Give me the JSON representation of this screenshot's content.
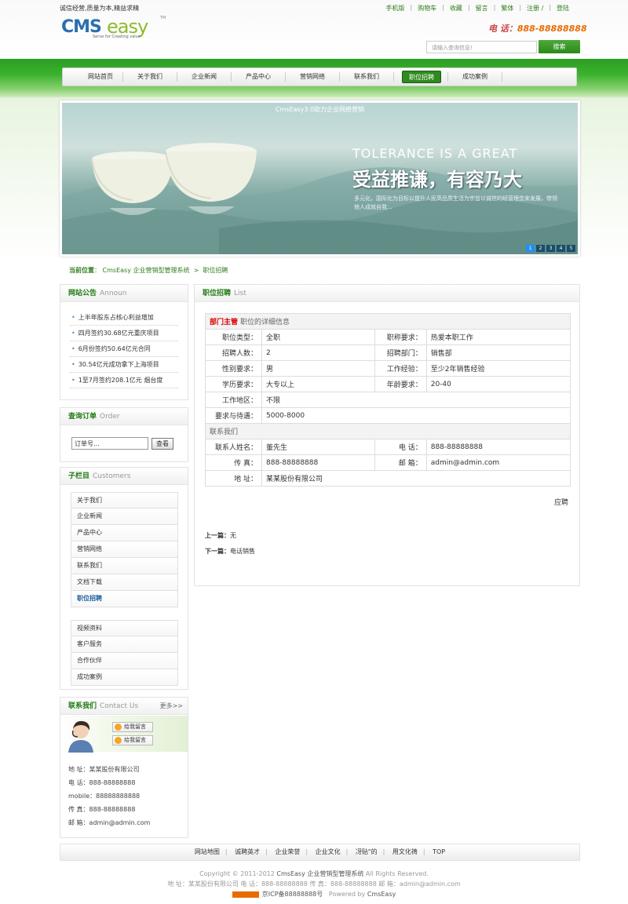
{
  "top": {
    "slogan": "诚信经营,质量为本,精益求精",
    "links": [
      "手机版",
      "购物车",
      "收藏",
      "留言",
      "繁体",
      "注册 /",
      "登陆"
    ]
  },
  "logo": {
    "cms": "CMS",
    "easy": "easy",
    "tm": "TM",
    "tagline": "Serve for Creating value"
  },
  "header": {
    "phone_label": "电 话：",
    "phone_number": "888-88888888",
    "search_placeholder": "请输入查询信息!",
    "search_button": "搜索"
  },
  "nav": {
    "items": [
      "网站首页",
      "关于我们",
      "企业新闻",
      "产品中心",
      "营销网络",
      "联系我们",
      "职位招聘",
      "成功案例"
    ],
    "active_index": 6
  },
  "banner": {
    "title": "CmsEasy3.0助力企业网络营销",
    "en": "TOLERANCE IS A GREAT",
    "cn": "受益推谦，有容乃大",
    "sub": "多元化，国际化为目标以提升人民高品质生活为宗旨以诚信的经营理念来发展，带领他人成就自我...",
    "dots": [
      "1",
      "2",
      "3",
      "4",
      "5"
    ]
  },
  "breadcrumb": {
    "label": "当前位置",
    "sep1": "：",
    "home": "CmsEasy 企业营销型管理系统",
    "sep2": ">",
    "current": "职位招聘"
  },
  "notice": {
    "title": "网站公告",
    "title_en": "Announ",
    "items": [
      "上半年股东占核心利益增加",
      "四月签约30.68亿元重庆项目",
      "6月份签约50.64亿元合同",
      "30.54亿元成功拿下上海项目",
      "1至7月签约208.1亿元 烟台度"
    ]
  },
  "order": {
    "title": "查询订单",
    "title_en": "Order",
    "input_value": "订单号...",
    "button": "查看"
  },
  "subnav": {
    "title": "子栏目",
    "title_en": "Customers",
    "group1": [
      "关于我们",
      "企业新闻",
      "产品中心",
      "营销网络",
      "联系我们",
      "文档下载",
      "职位招聘"
    ],
    "group2": [
      "视频资料",
      "客户服务",
      "合作伙伴",
      "成功案例"
    ],
    "active": "职位招聘"
  },
  "contact": {
    "title": "联系我们",
    "title_en": "Contact Us",
    "more": "更多>>",
    "qq_buttons": [
      "给我留言",
      "给我留言"
    ],
    "lines": [
      "地 址：某某股份有限公司",
      "电 话：888-88888888",
      "mobile：88888888888",
      "传 真：888-88888888",
      "邮 箱：admin@admin.com"
    ]
  },
  "main": {
    "title": "职位招聘",
    "title_en": "List",
    "section_title": "部门主管",
    "section_sub": "职位的详细信息",
    "rows": [
      {
        "l1": "职位类型：",
        "v1": "全职",
        "l2": "职称要求：",
        "v2": "热爱本职工作"
      },
      {
        "l1": "招聘人数：",
        "v1": "2",
        "l2": "招聘部门：",
        "v2": "销售部"
      },
      {
        "l1": "性别要求：",
        "v1": "男",
        "l2": "工作经验：",
        "v2": "至少2年销售经验"
      },
      {
        "l1": "学历要求：",
        "v1": "大专以上",
        "l2": "年龄要求：",
        "v2": "20-40"
      }
    ],
    "area_label": "工作地区：",
    "area_value": "不限",
    "pay_label": "要求与待遇：",
    "pay_value": "5000-8000",
    "contact_section": "联系我们",
    "contact_rows": [
      {
        "l1": "联系人姓名：",
        "v1": "董先生",
        "l2": "电 话：",
        "v2": "888-88888888"
      },
      {
        "l1": "传 真：",
        "v1": "888-88888888",
        "l2": "邮 箱：",
        "v2": "admin@admin.com"
      }
    ],
    "address_label": "地 址：",
    "address_value": "某某股份有限公司",
    "apply": "应聘",
    "prev_label": "上一篇：",
    "prev_value": "无",
    "next_label": "下一篇：",
    "next_value": "电话销售"
  },
  "footer": {
    "links": [
      "网站地图",
      "诚聘英才",
      "企业荣誉",
      "企业文化",
      "冴贴\"的",
      "用文化祷",
      "TOP"
    ],
    "copyright_pre": "Copyright © 2011-2012",
    "copyright_brand": "CmsEasy 企业营销型管理系统",
    "copyright_post": "All Rights Reserved.",
    "address_line": "地 址：某某股份有限公司 电 话：888-88888888 传 真：888-88888888 邮 箱：admin@admin.com",
    "icp": "京ICP备88888888号",
    "powered": "Powered by",
    "powered_brand": "CmsEasy"
  },
  "colors": {
    "brand_green": "#2f8a1f",
    "phone_orange": "#e96a00",
    "link_green": "#2d7d1a"
  }
}
